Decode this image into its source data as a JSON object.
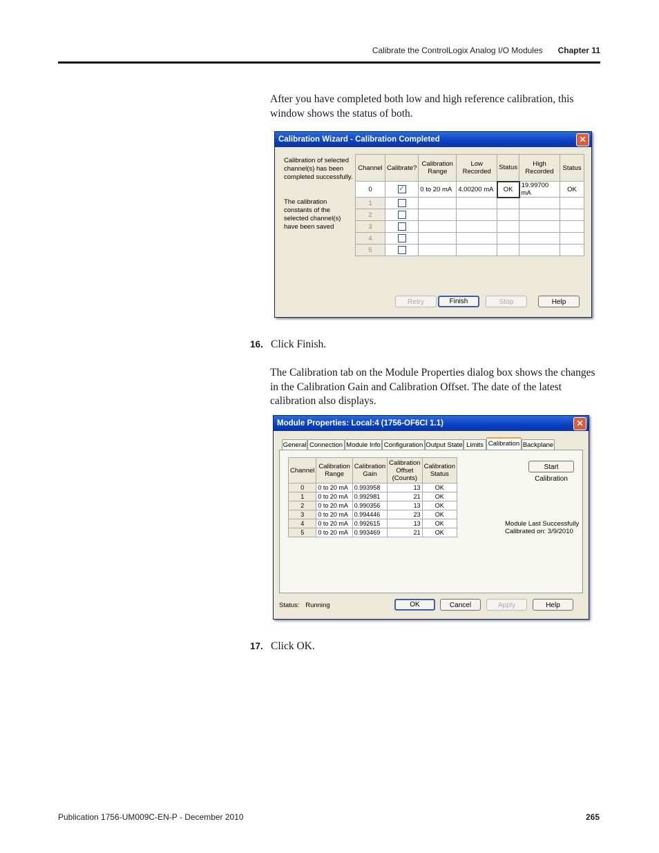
{
  "header": {
    "section": "Calibrate the ControlLogix Analog I/O Modules",
    "chapter": "Chapter 11"
  },
  "intro_text": "After you have completed both low and high reference calibration, this window shows the status of both.",
  "wizard": {
    "title": "Calibration Wizard - Calibration Completed",
    "close_glyph": "✕",
    "message1": "Calibration of selected channel(s) has been completed successfully.",
    "message2": "The calibration constants of the selected channel(s) have been saved",
    "columns": [
      "Channel",
      "Calibrate?",
      "Calibration Range",
      "Low Recorded",
      "Status",
      "High Recorded",
      "Status"
    ],
    "rows": [
      {
        "channel": "0",
        "checked": true,
        "range": "0 to 20 mA",
        "low": "4.00200 mA",
        "low_status": "OK",
        "high": "19.99700 mA",
        "high_status": "OK"
      },
      {
        "channel": "1",
        "checked": false,
        "range": "",
        "low": "",
        "low_status": "",
        "high": "",
        "high_status": ""
      },
      {
        "channel": "2",
        "checked": false,
        "range": "",
        "low": "",
        "low_status": "",
        "high": "",
        "high_status": ""
      },
      {
        "channel": "3",
        "checked": false,
        "range": "",
        "low": "",
        "low_status": "",
        "high": "",
        "high_status": ""
      },
      {
        "channel": "4",
        "checked": false,
        "range": "",
        "low": "",
        "low_status": "",
        "high": "",
        "high_status": ""
      },
      {
        "channel": "5",
        "checked": false,
        "range": "",
        "low": "",
        "low_status": "",
        "high": "",
        "high_status": ""
      }
    ],
    "buttons": {
      "retry": "Retry",
      "finish": "Finish",
      "stop": "Stop",
      "help": "Help"
    }
  },
  "step16": {
    "number": "16.",
    "text": "Click Finish."
  },
  "mid_text": "The Calibration tab on the Module Properties dialog box shows the changes in the Calibration Gain and Calibration Offset. The date of the latest calibration also displays.",
  "module": {
    "title": "Module Properties: Local:4 (1756-OF6CI 1.1)",
    "close_glyph": "✕",
    "tabs": [
      "General",
      "Connection",
      "Module Info",
      "Configuration",
      "Output State",
      "Limits",
      "Calibration",
      "Backplane"
    ],
    "columns": [
      "Channel",
      "Calibration Range",
      "Calibration Gain",
      "Calibration Offset (Counts)",
      "Calibration Status"
    ],
    "rows": [
      {
        "channel": "0",
        "range": "0 to 20 mA",
        "gain": "0.993958",
        "offset": "13",
        "status": "OK"
      },
      {
        "channel": "1",
        "range": "0 to 20 mA",
        "gain": "0.992981",
        "offset": "21",
        "status": "OK"
      },
      {
        "channel": "2",
        "range": "0 to 20 mA",
        "gain": "0.990356",
        "offset": "13",
        "status": "OK"
      },
      {
        "channel": "3",
        "range": "0 to 20 mA",
        "gain": "0.994446",
        "offset": "23",
        "status": "OK"
      },
      {
        "channel": "4",
        "range": "0 to 20 mA",
        "gain": "0.992615",
        "offset": "13",
        "status": "OK"
      },
      {
        "channel": "5",
        "range": "0 to 20 mA",
        "gain": "0.993469",
        "offset": "21",
        "status": "OK"
      }
    ],
    "start_button": "Start Calibration",
    "last_cal_line1": "Module Last Successfully",
    "last_cal_line2": "Calibrated on:  3/9/2010",
    "status_label": "Status:",
    "status_value": "Running",
    "buttons": {
      "ok": "OK",
      "cancel": "Cancel",
      "apply": "Apply",
      "help": "Help"
    }
  },
  "step17": {
    "number": "17.",
    "text": "Click OK."
  },
  "footer": {
    "publication": "Publication 1756-UM009C-EN-P - December 2010",
    "page": "265"
  }
}
